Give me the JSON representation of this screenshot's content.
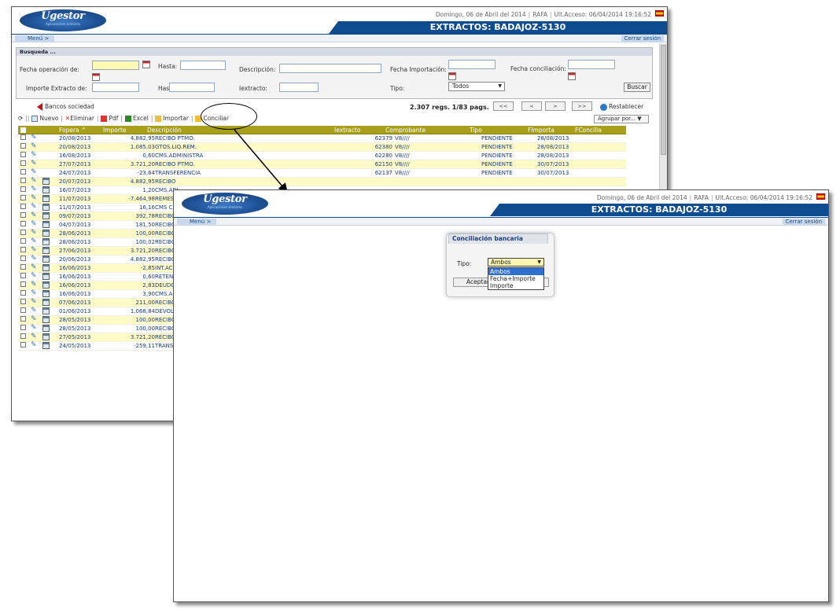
{
  "app_name": "Ugestor",
  "app_tagline": "Aplicaciones similares",
  "header": {
    "date": "Domingo, 06 de Abril del 2014",
    "user": "RAFA",
    "last_access": "Ult.Acceso: 06/04/2014 19:16:52",
    "title": "EXTRACTOS: BADAJOZ-5130",
    "menu_label": "Menú >",
    "logout_label": "Cerrar sesión"
  },
  "search": {
    "title": "Busqueda ...",
    "fecha_operacion_label": "Fecha operación de:",
    "hasta_label": "Hasta:",
    "descripcion_label": "Descripción:",
    "fecha_importacion_label": "Fecha Importación:",
    "fecha_conciliacion_label": "Fecha conciliación:",
    "importe_label": "Importe Extracto de:",
    "hasta2_label": "Hasta:",
    "iextracto_label": "Iextracto:",
    "tipo_label": "Tipo:",
    "tipo_value": "Todos",
    "buscar_label": "Buscar"
  },
  "toolbar": {
    "bancos_label": "Bancos sociedad",
    "page_count": "2.307 regs. 1/83 pags.",
    "first_label": "<<",
    "prev_label": "<",
    "next_label": ">",
    "last_label": ">>",
    "restablecer_label": "Restablecer",
    "nuevo_label": "Nuevo",
    "eliminar_label": "Eliminar",
    "pdf_label": "Pdf",
    "excel_label": "Excel",
    "importar_label": "Importar",
    "conciliar_label": "Conciliar",
    "agrupar_label": "Agrupar por..."
  },
  "grid": {
    "headers": {
      "fopera": "Fopera ^",
      "importe": "Importe",
      "descripcion": "Descripción",
      "iextracto": "Iextracto",
      "comprobante": "Comprobante",
      "tipo": "Tipo",
      "fimporta": "FImporta",
      "fconcilia": "FConcilia"
    },
    "rows": [
      {
        "fopera": "20/08/2013",
        "importe": "4.882,95",
        "desc": "RECIBO PTMO.",
        "iext": "62379",
        "comp": "V8////",
        "tipo": "PENDIENTE",
        "fimp": "28/08/2013"
      },
      {
        "fopera": "20/08/2013",
        "importe": "1.085,03",
        "desc": "GTOS.LIQ.REM.",
        "iext": "62380",
        "comp": "V8////",
        "tipo": "PENDIENTE",
        "fimp": "28/08/2013"
      },
      {
        "fopera": "16/08/2013",
        "importe": "0,60",
        "desc": "CMS.ADMINISTRA",
        "iext": "62280",
        "comp": "V8////",
        "tipo": "PENDIENTE",
        "fimp": "28/08/2013"
      },
      {
        "fopera": "27/07/2013",
        "importe": "3.721,20",
        "desc": "RECIBO PTMO.",
        "iext": "62150",
        "comp": "V8////",
        "tipo": "PENDIENTE",
        "fimp": "30/07/2013"
      },
      {
        "fopera": "24/07/2013",
        "importe": "-23,64",
        "desc": "TRANSFERENCIA",
        "iext": "62137",
        "comp": "V8////",
        "tipo": "PENDIENTE",
        "fimp": "30/07/2013"
      },
      {
        "fopera": "20/07/2013",
        "importe": "4.882,95",
        "desc": "RECIBO"
      },
      {
        "fopera": "16/07/2013",
        "importe": "1,20",
        "desc": "CMS.ADI"
      },
      {
        "fopera": "11/07/2013",
        "importe": "-7.464,98",
        "desc": "REMESA"
      },
      {
        "fopera": "11/07/2013",
        "importe": "16,16",
        "desc": "CMS CH"
      },
      {
        "fopera": "09/07/2013",
        "importe": "392,78",
        "desc": "RECIBO"
      },
      {
        "fopera": "04/07/2013",
        "importe": "181,50",
        "desc": "RECIBO"
      },
      {
        "fopera": "28/06/2013",
        "importe": "100,00",
        "desc": "RECIBO"
      },
      {
        "fopera": "28/06/2013",
        "importe": "100,02",
        "desc": "RECIBO"
      },
      {
        "fopera": "27/06/2013",
        "importe": "3.721,20",
        "desc": "RECIBO"
      },
      {
        "fopera": "20/06/2013",
        "importe": "4.882,95",
        "desc": "RECIBO"
      },
      {
        "fopera": "16/06/2013",
        "importe": "-2,85",
        "desc": "INT.ACR"
      },
      {
        "fopera": "16/06/2013",
        "importe": "0,60",
        "desc": "RETENCI"
      },
      {
        "fopera": "16/06/2013",
        "importe": "2,83",
        "desc": "DEUDOR"
      },
      {
        "fopera": "16/06/2013",
        "importe": "3,90",
        "desc": "CMS.AD"
      },
      {
        "fopera": "07/06/2013",
        "importe": "211,00",
        "desc": "RECIBO"
      },
      {
        "fopera": "01/06/2013",
        "importe": "1.068,84",
        "desc": "DEVOLU"
      },
      {
        "fopera": "28/05/2013",
        "importe": "100,00",
        "desc": "RECIBO"
      },
      {
        "fopera": "28/05/2013",
        "importe": "100,00",
        "desc": "RECIBO"
      },
      {
        "fopera": "27/05/2013",
        "importe": "3.721,20",
        "desc": "RECIBO"
      },
      {
        "fopera": "24/05/2013",
        "importe": "-259,11",
        "desc": "TRANSFE"
      }
    ]
  },
  "dialog": {
    "title": "Conciliación bancaria",
    "tipo_label": "Tipo:",
    "selected": "Ambos",
    "options": [
      "Ambos",
      "Fecha+Importe",
      "Importe"
    ],
    "accept_label": "Aceptar"
  },
  "colors": {
    "title_bar": "#0e4c8f",
    "grid_header": "#a89f1a",
    "row_alt": "#fdfbc6",
    "link_text": "#1e3d7a",
    "highlight_input": "#fdf9b0"
  }
}
